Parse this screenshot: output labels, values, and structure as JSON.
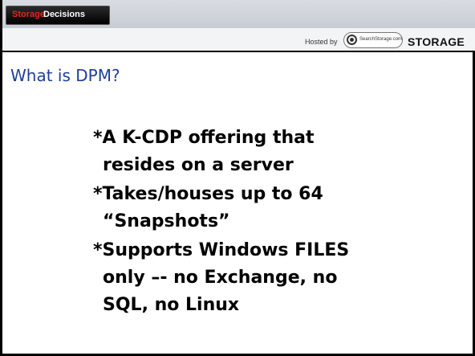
{
  "header": {
    "brand_part1": "Storage",
    "brand_part2": "Decisions",
    "hosted_by": "Hosted by",
    "logo_text": "SearchStorage.com",
    "storage_word": "STORAGE"
  },
  "slide": {
    "title": "What is DPM?",
    "bullets": [
      {
        "lines": [
          "*A K-CDP offering that",
          "resides on a server"
        ]
      },
      {
        "lines": [
          "*Takes/houses up to 64",
          "“Snapshots”"
        ]
      },
      {
        "lines": [
          "*Supports Windows FILES",
          "only –- no Exchange, no",
          "SQL, no Linux"
        ]
      }
    ]
  },
  "colors": {
    "title": "#1f3f97",
    "brand_red": "#e3261c",
    "border": "#000000"
  }
}
